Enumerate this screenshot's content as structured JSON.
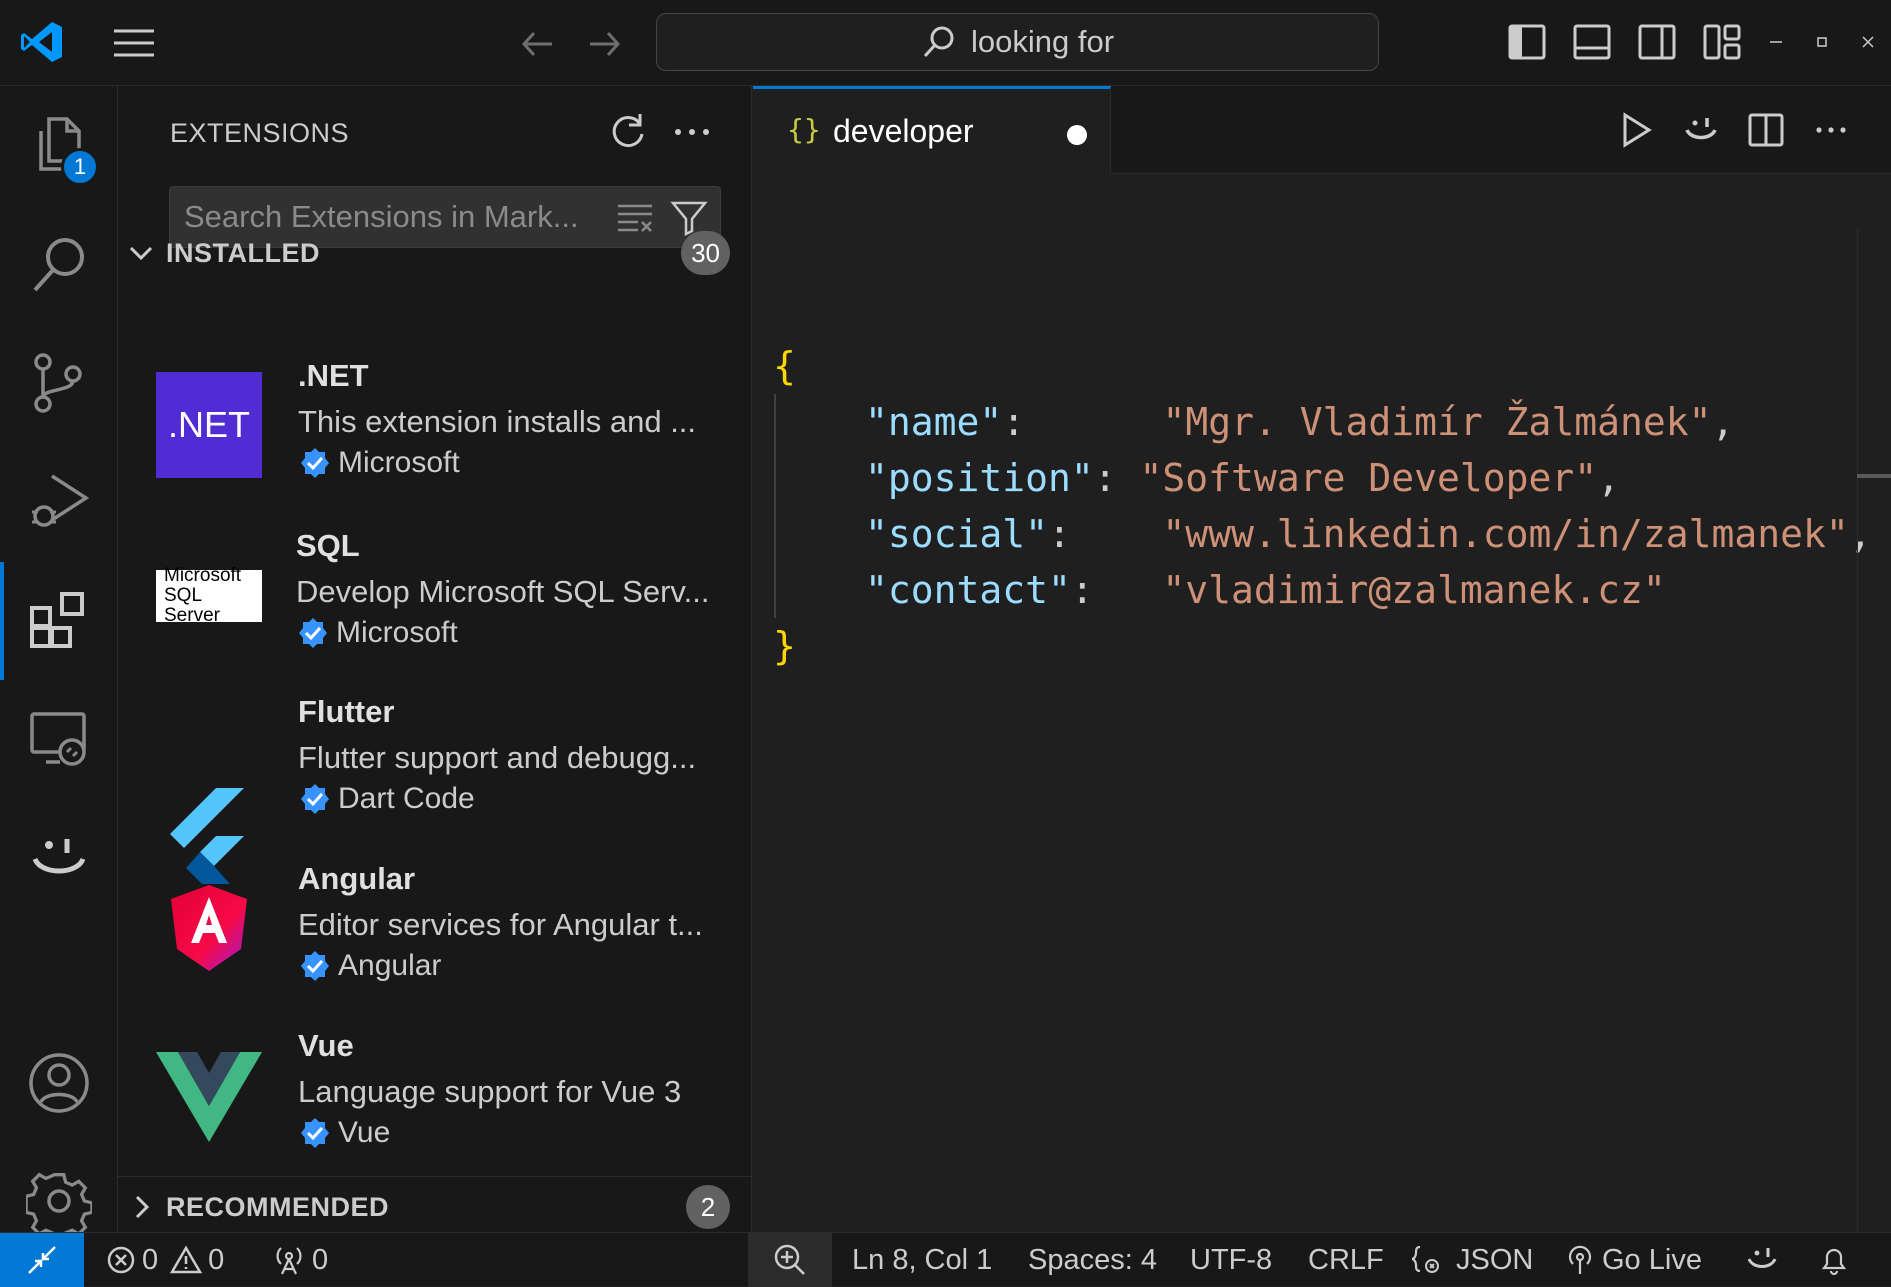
{
  "titlebar": {
    "search_text": "looking for",
    "app_icon": "vscode-logo-icon"
  },
  "activity_bar": {
    "explorer_badge": "1",
    "items": [
      "explorer-icon",
      "search-icon",
      "source-control-icon",
      "run-debug-icon",
      "extensions-icon",
      "remote-explorer-icon",
      "copilot-icon",
      "account-icon",
      "settings-gear-icon"
    ],
    "active": "extensions-icon"
  },
  "sidebar": {
    "title": "EXTENSIONS",
    "search_placeholder": "Search Extensions in Mark...",
    "installed": {
      "label": "INSTALLED",
      "count": "30",
      "items": [
        {
          "name": ".NET",
          "logo_text": ".NET",
          "description": "This extension installs and ...",
          "publisher": "Microsoft"
        },
        {
          "name": "SQL",
          "logo_text_1": "Microsoft",
          "logo_text_2": "SQL Server",
          "description": "Develop Microsoft SQL Serv...",
          "publisher": "Microsoft"
        },
        {
          "name": "Flutter",
          "description": "Flutter support and debugg...",
          "publisher": "Dart Code"
        },
        {
          "name": "Angular",
          "description": "Editor services for Angular t...",
          "publisher": "Angular"
        },
        {
          "name": "Vue",
          "description": "Language support for Vue 3",
          "publisher": "Vue"
        }
      ]
    },
    "recommended": {
      "label": "RECOMMENDED",
      "count": "2"
    }
  },
  "editor": {
    "tab": {
      "icon": "{}",
      "title": "developer",
      "dirty": true
    },
    "code": {
      "open_brace": "{",
      "close_brace": "}",
      "lines": [
        {
          "key": "\"name\"",
          "sep": ":      ",
          "value": "\"Mgr. Vladimír Žalmánek\"",
          "trail": ","
        },
        {
          "key": "\"position\"",
          "sep": ": ",
          "value": "\"Software Developer\"",
          "trail": ","
        },
        {
          "key": "\"social\"",
          "sep": ":    ",
          "value": "\"www.linkedin.com/in/zalmanek\"",
          "trail": ","
        },
        {
          "key": "\"contact\"",
          "sep": ":   ",
          "value": "\"vladimir@zalmanek.cz\"",
          "trail": ""
        }
      ]
    }
  },
  "statusbar": {
    "errors": "0",
    "warnings": "0",
    "ports": "0",
    "cursor": "Ln 8, Col 1",
    "spaces": "Spaces: 4",
    "encoding": "UTF-8",
    "eol": "CRLF",
    "language": "JSON",
    "go_live": "Go Live"
  },
  "colors": {
    "accent": "#0078d4",
    "string": "#ce9178",
    "key": "#9cdcfe",
    "brace": "#ffd700",
    "dotnet_purple": "#512bd4"
  }
}
